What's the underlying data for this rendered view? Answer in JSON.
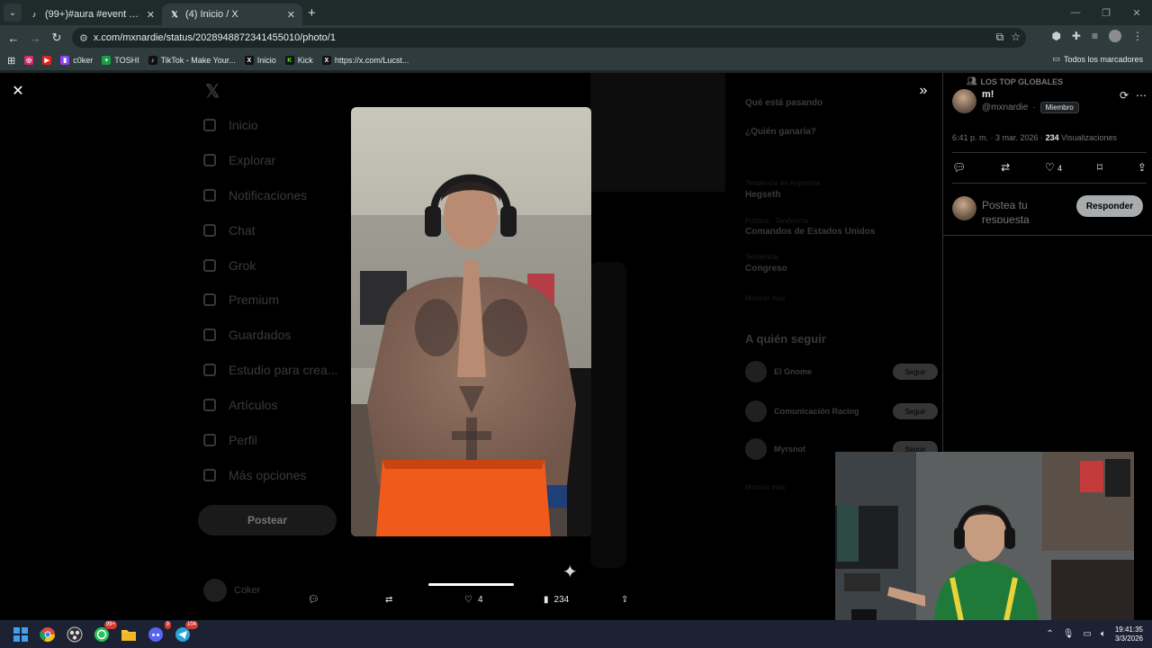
{
  "browser": {
    "tabs": [
      {
        "title": "(99+)#aura #event #meteorolo",
        "favicon": "tiktok-icon",
        "active": false
      },
      {
        "title": "(4) Inicio / X",
        "favicon": "x-icon",
        "active": true
      }
    ],
    "new_tab": "+",
    "url_prefix_icon": "site-settings-icon",
    "url": "x.com/mxnardie/status/2028948872341455010/photo/1",
    "bookmarks": [
      {
        "label": "",
        "icon": "instagram-icon",
        "color": "#d6296f"
      },
      {
        "label": "",
        "icon": "youtube-icon",
        "color": "#e62117"
      },
      {
        "label": "c0ker",
        "icon": "twitch-icon",
        "color": "#8b44f7"
      },
      {
        "label": "TOSHI",
        "icon": "plus-icon",
        "color": "#1a9e43"
      },
      {
        "label": "TikTok - Make Your...",
        "icon": "tiktok-icon",
        "color": "#111111"
      },
      {
        "label": "Inicio",
        "icon": "x-icon",
        "color": "#111111"
      },
      {
        "label": "Kick",
        "icon": "kick-icon",
        "color": "#53fc18"
      },
      {
        "label": "https://x.com/Lucst...",
        "icon": "x-icon",
        "color": "#111111"
      }
    ],
    "all_bookmarks": "Todos los marcadores"
  },
  "x_nav": {
    "items": [
      "Inicio",
      "Explorar",
      "Notificaciones",
      "Chat",
      "Grok",
      "Premium",
      "Guardados",
      "Estudio para crea...",
      "Artículos",
      "Perfil",
      "Más opciones"
    ],
    "post_button": "Postear",
    "user_name": "Coker"
  },
  "right_column": {
    "lines": [
      {
        "text": "Qué está pasando",
        "style": "b"
      },
      {
        "text": "¿Quién ganaría?",
        "style": "b"
      },
      {
        "text": "Tendencia en Argentina",
        "style": "s"
      },
      {
        "text": "Hegseth",
        "style": "b"
      },
      {
        "text": "Política · Tendencia",
        "style": "s"
      },
      {
        "text": "Comandos de Estados Unidos",
        "style": "b"
      },
      {
        "text": "Tendencia",
        "style": "s"
      },
      {
        "text": "Congreso",
        "style": "b"
      },
      {
        "text": "Mostrar más",
        "style": "s"
      }
    ],
    "who_to_follow": "A quién seguir",
    "follow_rows": [
      {
        "name": "El Gnome",
        "button": "Seguir"
      },
      {
        "name": "Comunicación Racing",
        "button": "Seguir"
      },
      {
        "name": "Myrsnot",
        "button": "Seguir"
      }
    ],
    "show_more": "Mostrar más"
  },
  "modal": {
    "close_icon": "close-icon",
    "expand_icon": "chevrons-right-icon",
    "progress": 1.0,
    "actions": {
      "reply_count": "",
      "repost_count": "",
      "like_count": "4",
      "views_count": "234"
    }
  },
  "tweet": {
    "context_label": "LOS TOP GLOBALES",
    "author_name": "m!",
    "handle": "@mxnardie",
    "separator": "·",
    "badge": "Miembro",
    "time": "6:41 p. m. · 3 mar. 2026 ·",
    "views": "234",
    "views_label": "Visualizaciones",
    "actions": {
      "like_count": "4"
    },
    "reply_placeholder": "Postea tu respuesta",
    "reply_button": "Responder"
  },
  "taskbar": {
    "badges": {
      "chrome": "",
      "whatsapp": "99+",
      "discord": "9",
      "telegram": "104"
    },
    "time": "19:41:35",
    "date": "3/3/2026"
  },
  "colors": {
    "x_accent": "#1d9bf0",
    "reply_button_bg": "#a9acae",
    "background": "#000000"
  }
}
